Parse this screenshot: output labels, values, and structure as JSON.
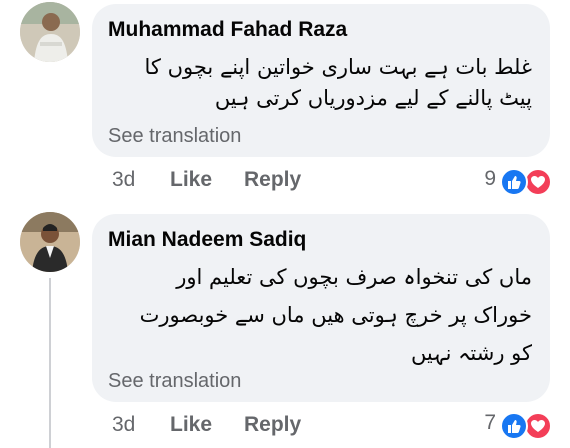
{
  "comments": [
    {
      "author": "Muhammad Fahad Raza",
      "lines": [
        "غلط بات ہے بہت ساری خواتین اپنے بچوں کا",
        "پیٹ پالنے کے لیے مزدوریاں کرتی ہیں"
      ],
      "see_translation": "See translation",
      "time": "3d",
      "like_label": "Like",
      "reply_label": "Reply",
      "reaction_count": "9"
    },
    {
      "author": "Mian Nadeem Sadiq",
      "lines": [
        "ماں کی تنخواہ صرف بچوں کی تعلیم اور",
        "خوراک پر خرچ ہوتی ھیں ماں سے خوبصورت",
        "کو رشتہ نہیں"
      ],
      "see_translation": "See translation",
      "time": "3d",
      "like_label": "Like",
      "reply_label": "Reply",
      "reaction_count": "7"
    }
  ],
  "colors": {
    "bubble": "#f0f2f5",
    "secondary_text": "#65676b",
    "like_blue": "#1877f2",
    "love_red": "#f33e58"
  },
  "icons": [
    "avatar",
    "like-reaction-icon",
    "love-reaction-icon"
  ]
}
